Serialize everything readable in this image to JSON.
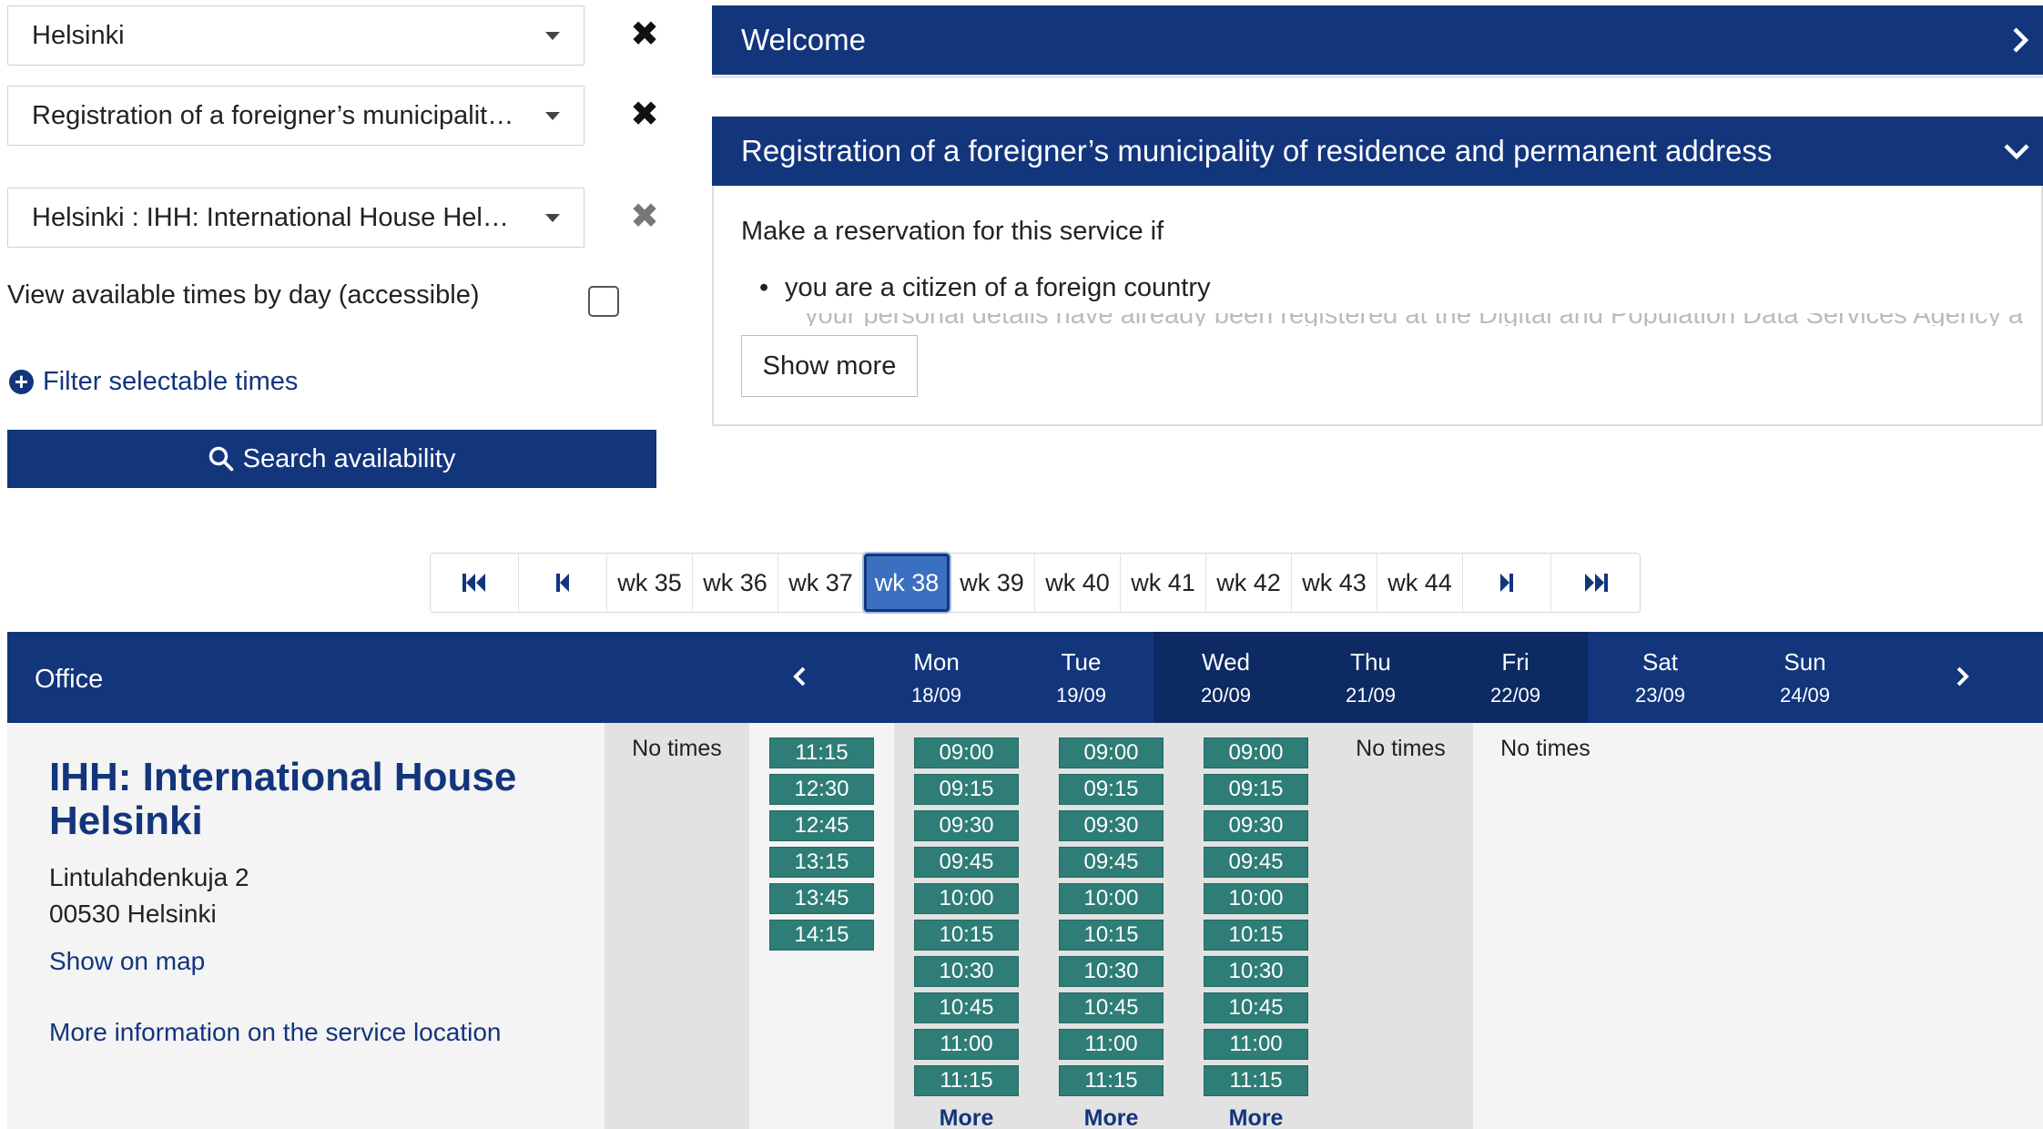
{
  "filters": {
    "location": {
      "value": "Helsinki"
    },
    "service": {
      "value": "Registration of a foreigner’s municipality of residence and permanent address"
    },
    "office": {
      "value": "Helsinki : IHH: International House Helsinki"
    },
    "view_by_day_label": "View available times by day (accessible)",
    "filter_times_label": "Filter selectable times",
    "search_label": "Search availability"
  },
  "panels": {
    "welcome_title": "Welcome",
    "service_title": "Registration of a foreigner’s municipality of residence and permanent address",
    "service_intro": "Make a reservation for this service if",
    "service_bullets": [
      "you are a citizen of a foreign country"
    ],
    "service_cut_line": "your personal details have already been registered at the Digital and Population Data Services Agency and",
    "show_more_label": "Show more"
  },
  "pager": {
    "weeks": [
      "wk 35",
      "wk 36",
      "wk 37",
      "wk 38",
      "wk 39",
      "wk 40",
      "wk 41",
      "wk 42",
      "wk 43",
      "wk 44"
    ],
    "active": "wk 38"
  },
  "calendar": {
    "office_header": "Office",
    "no_times_label": "No times",
    "more_label": "More",
    "days": [
      {
        "name": "Mon",
        "date": "18/09",
        "times": []
      },
      {
        "name": "Tue",
        "date": "19/09",
        "times": [
          "11:15",
          "12:30",
          "12:45",
          "13:15",
          "13:45",
          "14:15"
        ]
      },
      {
        "name": "Wed",
        "date": "20/09",
        "times": [
          "09:00",
          "09:15",
          "09:30",
          "09:45",
          "10:00",
          "10:15",
          "10:30",
          "10:45",
          "11:00",
          "11:15"
        ],
        "more": true
      },
      {
        "name": "Thu",
        "date": "21/09",
        "times": [
          "09:00",
          "09:15",
          "09:30",
          "09:45",
          "10:00",
          "10:15",
          "10:30",
          "10:45",
          "11:00",
          "11:15"
        ],
        "more": true
      },
      {
        "name": "Fri",
        "date": "22/09",
        "times": [
          "09:00",
          "09:15",
          "09:30",
          "09:45",
          "10:00",
          "10:15",
          "10:30",
          "10:45",
          "11:00",
          "11:15"
        ],
        "more": true
      },
      {
        "name": "Sat",
        "date": "23/09",
        "times": []
      },
      {
        "name": "Sun",
        "date": "24/09",
        "times": []
      }
    ]
  },
  "office": {
    "name": "IHH: International House Helsinki",
    "street": "Lintulahdenkuja 2",
    "city": "00530 Helsinki",
    "map_link": "Show on map",
    "info_link": "More information on the service location"
  },
  "colors": {
    "primary": "#12357c",
    "slot": "#2e7d76",
    "active_week": "#3b6fbf"
  }
}
